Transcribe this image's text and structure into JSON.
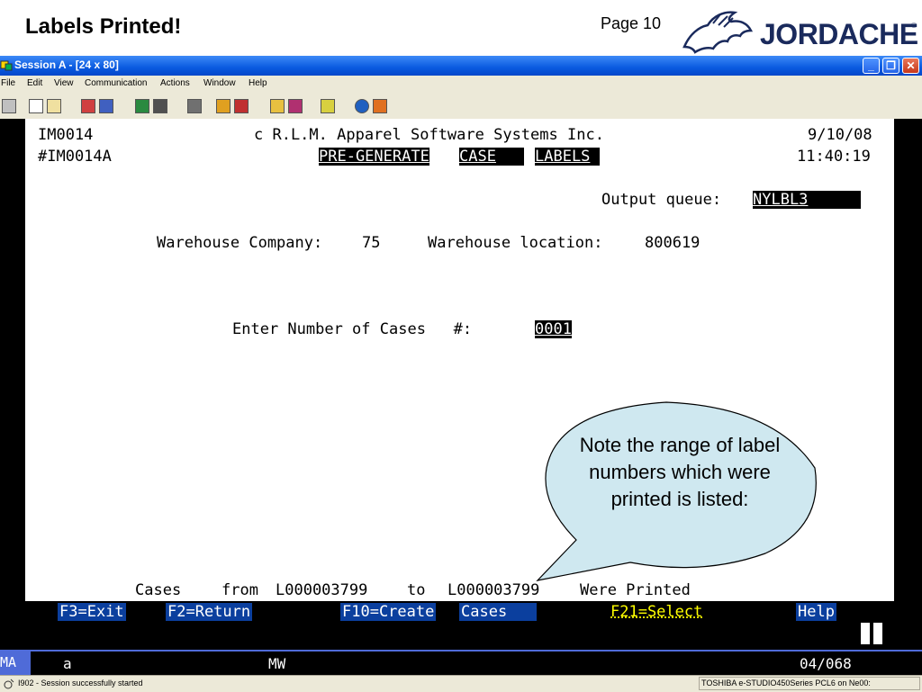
{
  "slide": {
    "title": "Labels Printed!",
    "page": "Page 10",
    "logo_text": "JORDACHE",
    "logo_reg": "®"
  },
  "window": {
    "title": "Session A - [24 x 80]",
    "controls": {
      "minimize": "_",
      "restore": "❐",
      "close": "✕"
    }
  },
  "menu": {
    "items": [
      "File",
      "Edit",
      "View",
      "Communication",
      "Actions",
      "Window",
      "Help"
    ]
  },
  "terminal": {
    "program_id": "IM0014",
    "screen_id": "#IM0014A",
    "company": "c R.L.M. Apparel Software Systems Inc.",
    "date": "9/10/08",
    "time": "11:40:19",
    "heading_1": "PRE-GENERATE",
    "heading_2": "CASE",
    "heading_3": "LABELS",
    "output_queue_label": "Output queue:",
    "output_queue_value": "NYLBL3",
    "warehouse_company_label": "Warehouse Company:",
    "warehouse_company_value": "75",
    "warehouse_location_label": "Warehouse location:",
    "warehouse_location_value": "800619",
    "cases_prompt": "Enter Number of Cases   #:",
    "cases_value": "0001",
    "result_cases": "Cases",
    "result_from": "from",
    "result_start": "L000003799",
    "result_to": "to",
    "result_end": "L000003799",
    "result_tail": "Were Printed",
    "fkeys": {
      "f3": "F3=Exit",
      "f2": "F2=Return",
      "f10": "F10=Create",
      "cases": "Cases",
      "f21": "F21=Select",
      "help": "Help"
    }
  },
  "oia": {
    "mode": "MA",
    "indicator": "a",
    "mw": "MW",
    "position": "04/068"
  },
  "status": {
    "message": "I902 - Session successfully started",
    "printer": "TOSHIBA e-STUDIO450Series PCL6 on Ne00:"
  },
  "callout": {
    "text": "Note the range of label numbers which were printed is listed:"
  },
  "colors": {
    "titlebar": "#0a5ae0",
    "callout_fill": "#cfe8f0",
    "fkey_selected": "#ffff00"
  }
}
